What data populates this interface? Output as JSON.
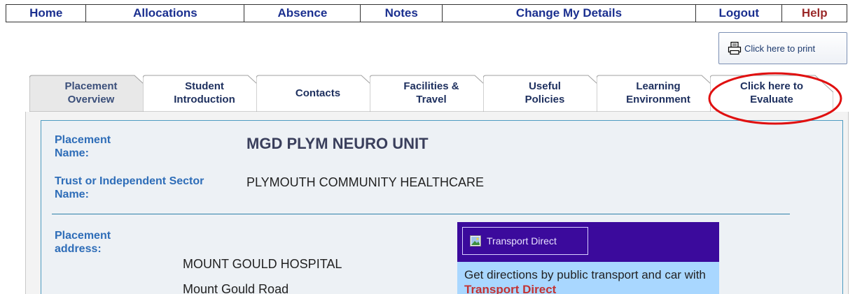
{
  "nav": {
    "items": [
      "Home",
      "Allocations",
      "Absence",
      "Notes",
      "Change My Details",
      "Logout",
      "Help"
    ]
  },
  "print": {
    "label": "Click here to print"
  },
  "tabs": [
    {
      "line1": "Placement",
      "line2": "Overview",
      "active": true
    },
    {
      "line1": "Student",
      "line2": "Introduction",
      "active": false
    },
    {
      "line1": "Contacts",
      "line2": "",
      "active": false
    },
    {
      "line1": "Facilities &",
      "line2": "Travel",
      "active": false
    },
    {
      "line1": "Useful",
      "line2": "Policies",
      "active": false
    },
    {
      "line1": "Learning",
      "line2": "Environment",
      "active": false
    },
    {
      "line1": "Click here to",
      "line2": "Evaluate",
      "active": false
    }
  ],
  "details": {
    "placement_name_label1": "Placement",
    "placement_name_label2": "Name:",
    "placement_name_value": "MGD PLYM NEURO UNIT",
    "trust_label1": "Trust or Independent Sector",
    "trust_label2": "Name:",
    "trust_value": "PLYMOUTH COMMUNITY HEALTHCARE",
    "address_label1": "Placement",
    "address_label2": "address:",
    "address_line1": "MOUNT GOULD HOSPITAL",
    "address_line2": "Mount Gould Road"
  },
  "transport": {
    "button_label": "Transport Direct",
    "body_text": "Get directions by public transport and car with ",
    "link_text": "Transport Direct"
  },
  "colors": {
    "nav_text": "#1a2f8f",
    "help_text": "#9b2a2a",
    "highlight_circle": "#e01010",
    "td_header": "#3b0a9c",
    "td_body": "#a9d7ff"
  }
}
